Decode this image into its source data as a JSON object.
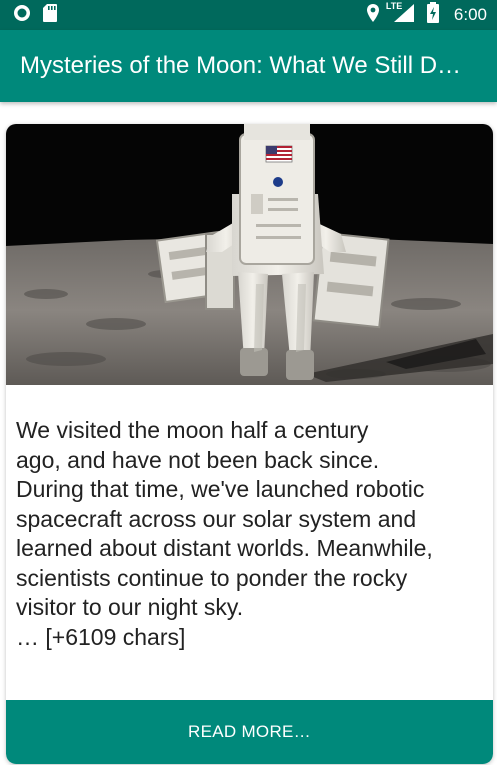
{
  "status_bar": {
    "time": "6:00",
    "network": "LTE",
    "icons": [
      "circle-notification-icon",
      "sd-card-icon",
      "location-icon",
      "signal-icon",
      "battery-charging-icon"
    ]
  },
  "app_bar": {
    "title": "Mysteries of the Moon: What We Still D…"
  },
  "article": {
    "image": "astronaut-on-moon-image",
    "text_lines": [
      "We visited the moon half a century",
      "ago, and have not been back since.",
      "During that time, we've launched robotic",
      "spacecraft across our solar system and",
      "learned about distant worlds. Meanwhile,",
      "scientists continue to ponder the rocky",
      "visitor to our night sky.",
      "… [+6109 chars]"
    ],
    "read_more_label": "READ MORE…"
  },
  "colors": {
    "status_bar": "#00695c",
    "primary": "#00897b",
    "text": "#222222"
  }
}
